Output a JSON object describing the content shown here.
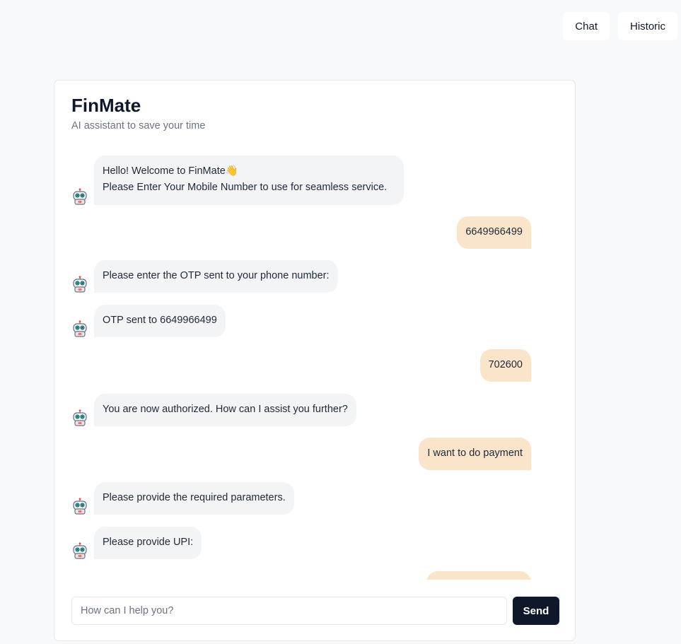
{
  "nav": {
    "chat_label": "Chat",
    "historic_label": "Historic"
  },
  "header": {
    "title": "FinMate",
    "subtitle": "AI assistant to save your time"
  },
  "messages": [
    {
      "from": "bot",
      "lines": [
        "Hello! Welcome to FinMate👋",
        "Please Enter Your Mobile Number to use for seamless service."
      ]
    },
    {
      "from": "user",
      "lines": [
        "6649966499"
      ]
    },
    {
      "from": "bot",
      "lines": [
        "Please enter the OTP sent to your phone number:"
      ]
    },
    {
      "from": "bot",
      "lines": [
        "OTP sent to 6649966499"
      ]
    },
    {
      "from": "user",
      "lines": [
        "702600"
      ]
    },
    {
      "from": "bot",
      "lines": [
        "You are now authorized. How can I assist you further?"
      ]
    },
    {
      "from": "user",
      "lines": [
        "I want to do payment"
      ]
    },
    {
      "from": "bot",
      "lines": [
        "Please provide the required parameters."
      ]
    },
    {
      "from": "bot",
      "lines": [
        "Please provide UPI:"
      ]
    },
    {
      "from": "user",
      "lines": [
        ""
      ]
    }
  ],
  "composer": {
    "placeholder": "How can I help you?",
    "value": "",
    "send_label": "Send"
  },
  "icons": {
    "avatar": "robot-avatar-icon"
  },
  "colors": {
    "user_bubble": "#fae5cb",
    "bot_bubble": "#f3f4f6",
    "send_button": "#0f172a"
  }
}
